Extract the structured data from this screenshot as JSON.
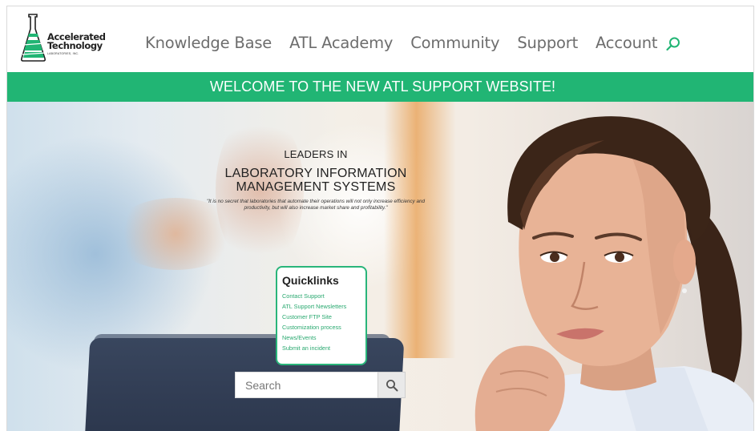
{
  "brand": {
    "logo_line1": "Accelerated",
    "logo_line2": "Technology",
    "logo_sub": "LABORATORIES, INC.",
    "accent_green": "#21b574"
  },
  "nav": {
    "items": [
      {
        "label": "Knowledge Base"
      },
      {
        "label": "ATL Academy"
      },
      {
        "label": "Community"
      },
      {
        "label": "Support"
      },
      {
        "label": "Account"
      }
    ],
    "search_icon": "search-icon"
  },
  "banner": {
    "text": "WELCOME TO THE NEW ATL SUPPORT WEBSITE!"
  },
  "hero": {
    "line1": "LEADERS IN",
    "line2a": "LABORATORY INFORMATION",
    "line2b": "MANAGEMENT SYSTEMS",
    "quote": "\"It is no secret that laboratories that automate their operations will not only increase efficiency and productivity, but will also increase market share and profitability.\""
  },
  "quicklinks": {
    "title": "Quicklinks",
    "links": [
      {
        "label": "Contact Support"
      },
      {
        "label": "ATL Support Newsletters"
      },
      {
        "label": "Customer FTP Site"
      },
      {
        "label": "Customization process"
      },
      {
        "label": "News/Events"
      },
      {
        "label": "Submit an incident"
      }
    ]
  },
  "search": {
    "placeholder": "Search",
    "button_icon": "magnifier-icon"
  }
}
